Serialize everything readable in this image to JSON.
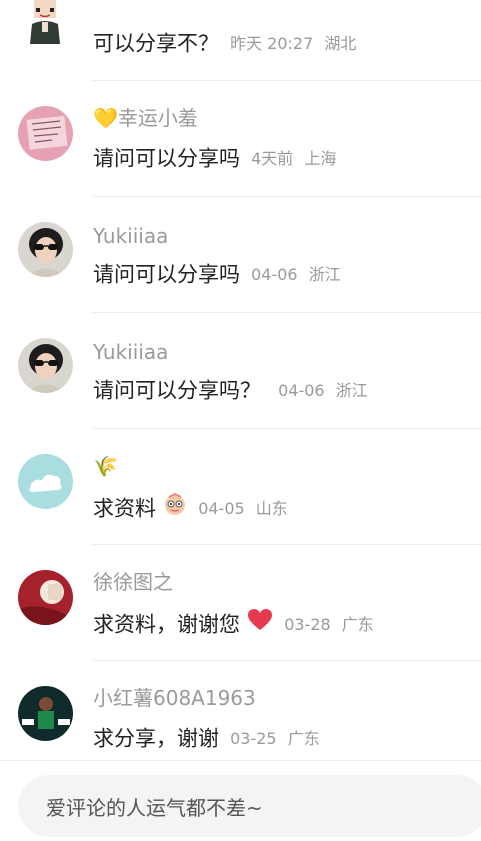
{
  "comments": [
    {
      "name": "",
      "text": "可以分享不？",
      "time": "昨天 20:27",
      "location": "湖北",
      "avatar_icon": "cartoon-avatar-icon"
    },
    {
      "name": "💛幸运小羞",
      "text": "请问可以分享吗",
      "time": "4天前",
      "location": "上海",
      "avatar_icon": "pink-note-avatar-icon"
    },
    {
      "name": "Yukiiiaa",
      "text": "请问可以分享吗",
      "time": "04-06",
      "location": "浙江",
      "avatar_icon": "sunglasses-girl-avatar-icon"
    },
    {
      "name": "Yukiiiaa",
      "text": "请问可以分享吗？",
      "time": "04-06",
      "location": "浙江",
      "avatar_icon": "sunglasses-girl-avatar-icon"
    },
    {
      "name": "🌾",
      "text": "求资料",
      "time": "04-05",
      "location": "山东",
      "avatar_icon": "cloud-avatar-icon",
      "emoji": "face-emoji-icon"
    },
    {
      "name": "徐徐图之",
      "text": "求资料，谢谢您",
      "time": "03-28",
      "location": "广东",
      "avatar_icon": "red-avatar-icon",
      "emoji": "heart-emoji-icon"
    },
    {
      "name": "小红薯608A1963",
      "text": "求分享，谢谢",
      "time": "03-25",
      "location": "广东",
      "avatar_icon": "sports-avatar-icon"
    }
  ],
  "composer": {
    "placeholder": "爱评论的人运气都不差~"
  }
}
